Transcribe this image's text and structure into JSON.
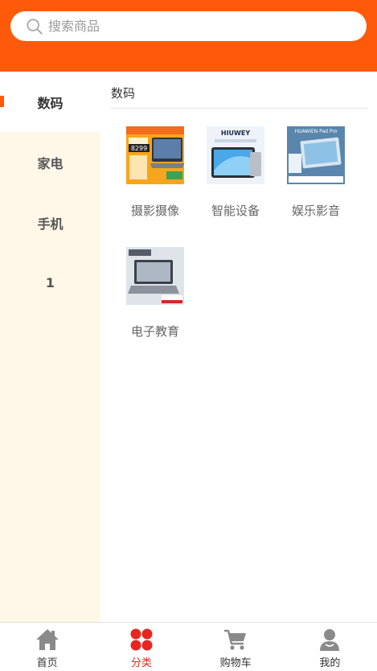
{
  "search": {
    "placeholder": "搜索商品"
  },
  "sidebar": {
    "items": [
      {
        "label": "数码",
        "active": true
      },
      {
        "label": "家电"
      },
      {
        "label": "手机"
      },
      {
        "label": "1"
      }
    ]
  },
  "content": {
    "title": "数码",
    "categories": [
      {
        "label": "摄影摄像",
        "thumb_text": "8299"
      },
      {
        "label": "智能设备",
        "thumb_text": "HIUWEY"
      },
      {
        "label": "娱乐影音",
        "thumb_text": "HUAWIEN Pad Pro"
      },
      {
        "label": "电子教育"
      }
    ]
  },
  "tabbar": {
    "items": [
      {
        "label": "首页"
      },
      {
        "label": "分类",
        "active": true
      },
      {
        "label": "购物车"
      },
      {
        "label": "我的"
      }
    ]
  },
  "colors": {
    "accent": "#ff5a0a",
    "tab_active": "#e8251f",
    "sidebar_bg": "#fff8e8"
  }
}
